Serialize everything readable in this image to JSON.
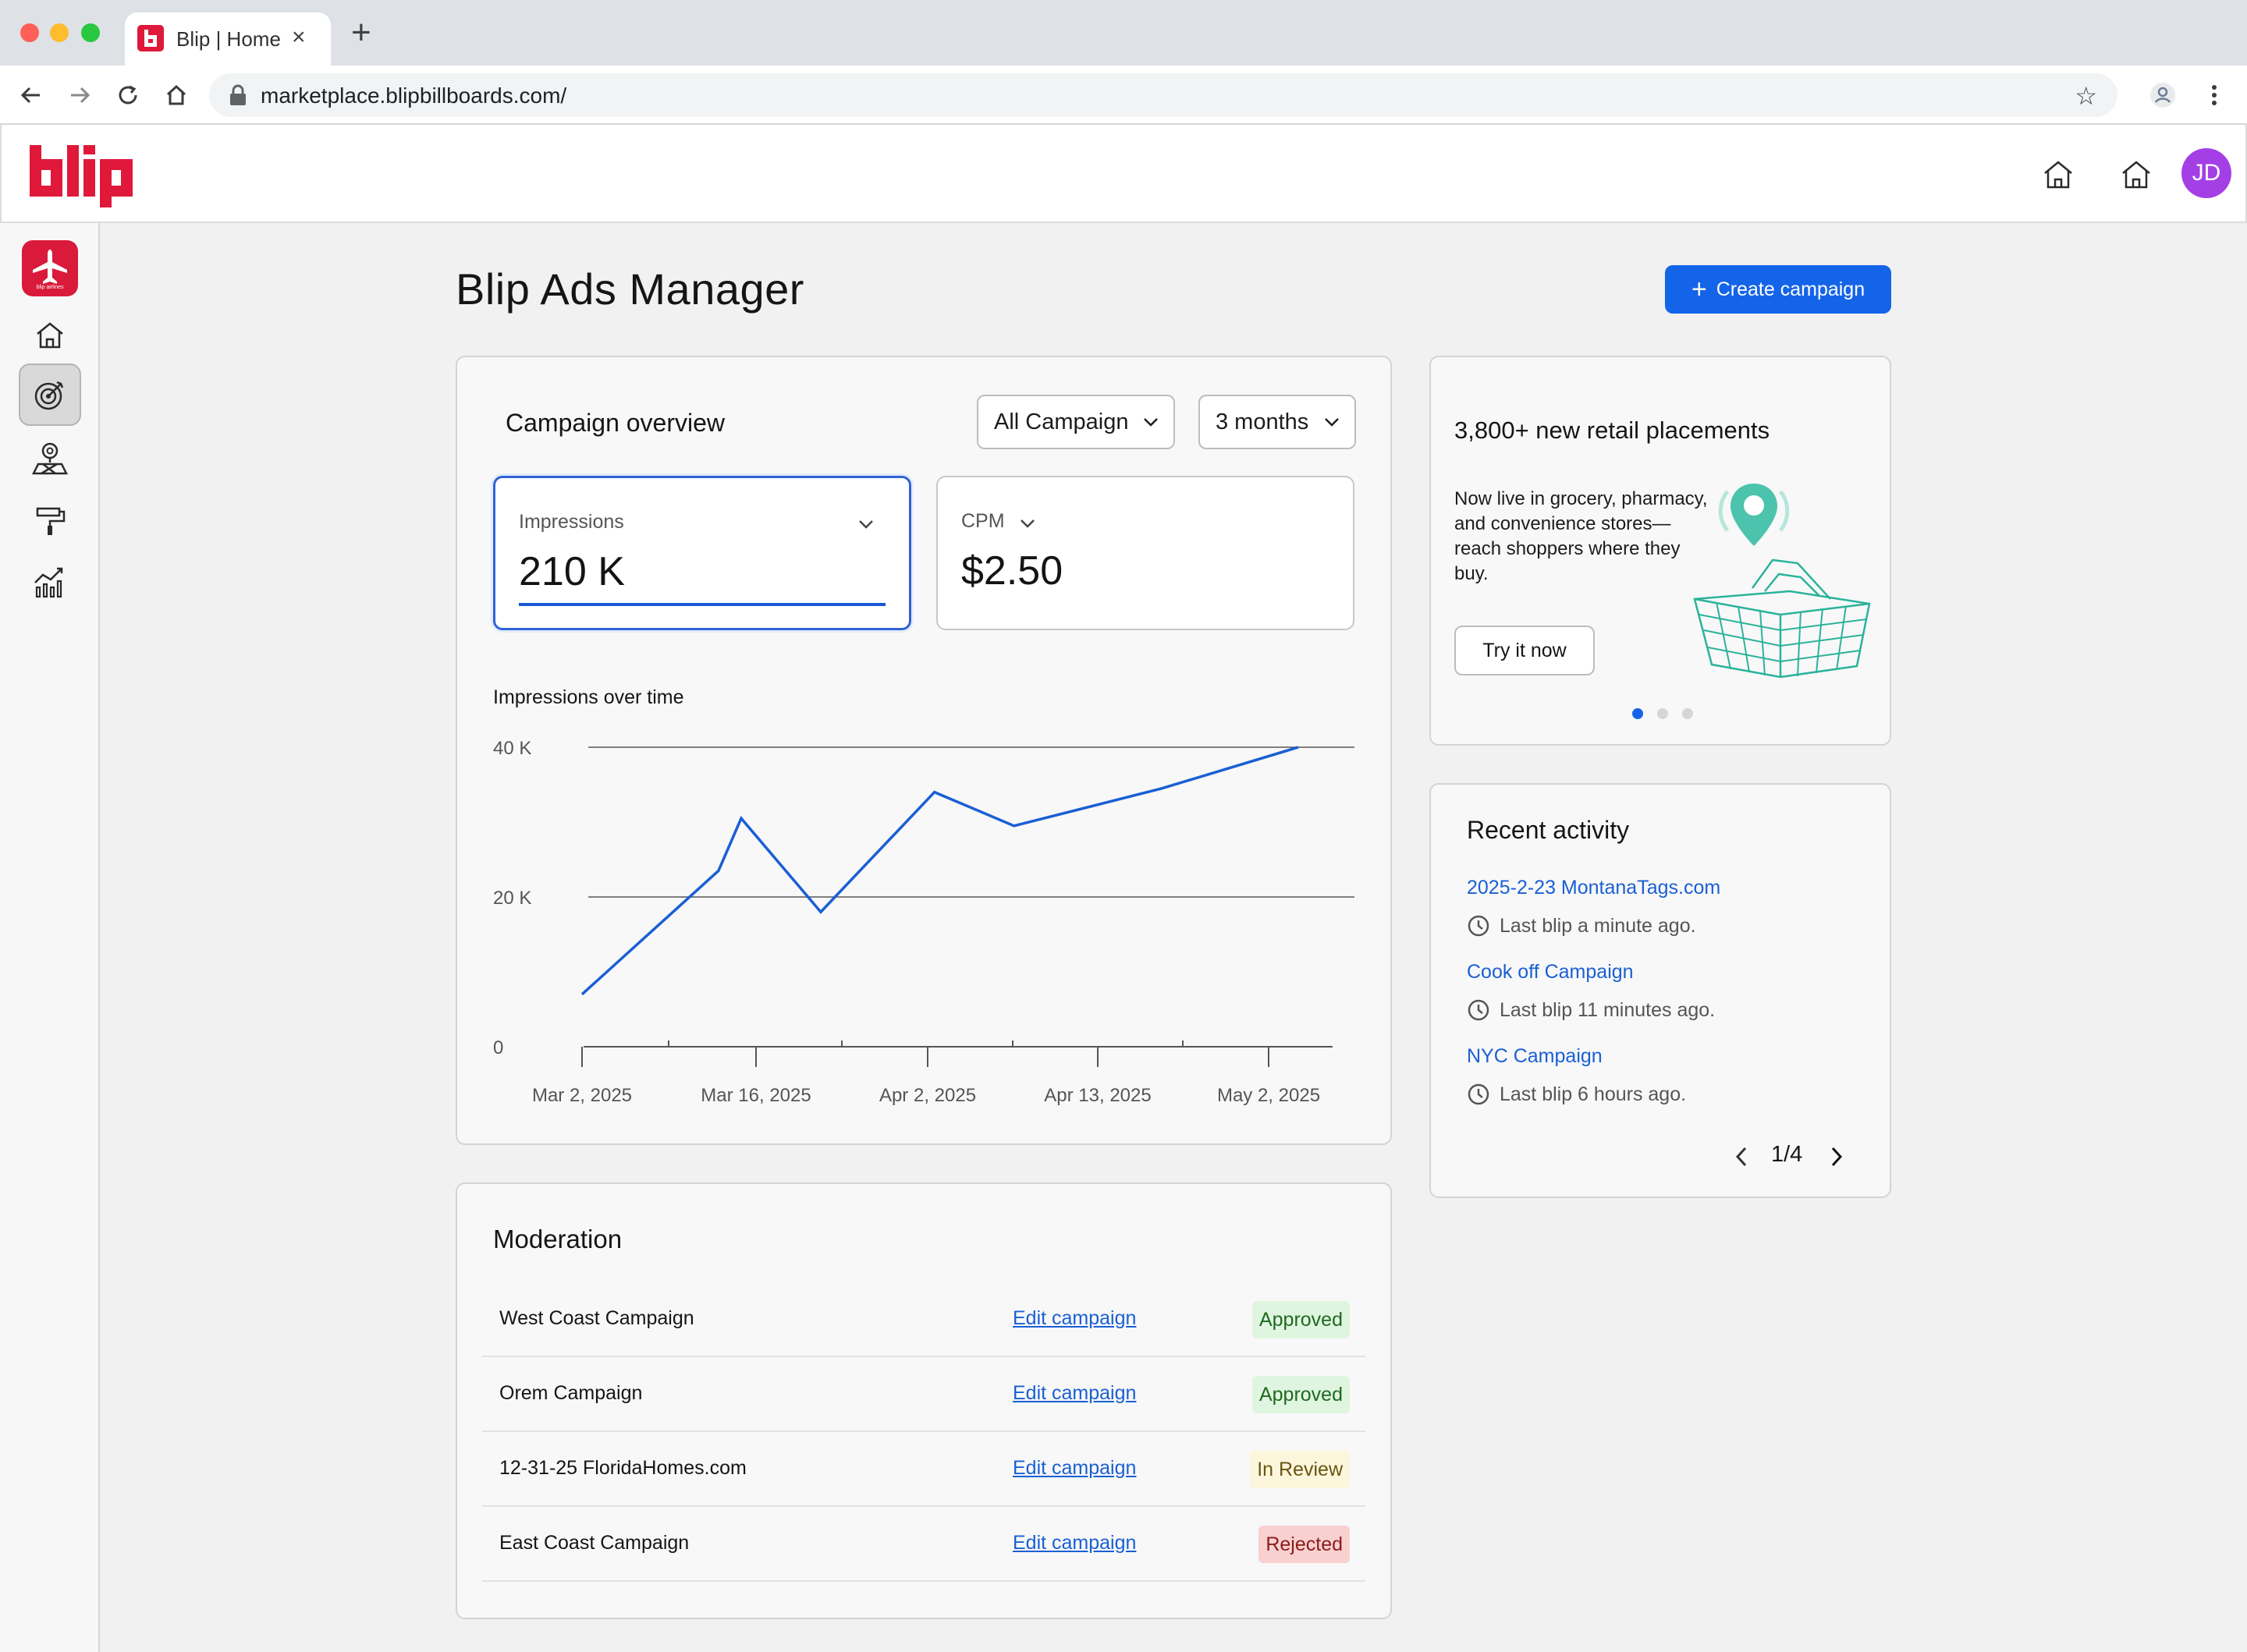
{
  "browser": {
    "tab_title": "Blip | Home",
    "url": "marketplace.blipbillboards.com/"
  },
  "header": {
    "logo_text": "blip",
    "avatar_initials": "JD"
  },
  "sidebar": {
    "brand_caption": "blip airlines",
    "items": [
      {
        "icon": "home-icon"
      },
      {
        "icon": "target-icon",
        "active": true
      },
      {
        "icon": "map-pin-icon"
      },
      {
        "icon": "paint-roller-icon"
      },
      {
        "icon": "analytics-icon"
      }
    ]
  },
  "page": {
    "title": "Blip Ads Manager",
    "create_button": "Create campaign"
  },
  "overview": {
    "title": "Campaign overview",
    "campaign_filter": "All Campaign",
    "period_filter": "3 months",
    "metrics": [
      {
        "label": "Impressions",
        "value": "210 K",
        "selected": true
      },
      {
        "label": "CPM",
        "value": "$2.50",
        "selected": false
      }
    ],
    "chart_title": "Impressions over time"
  },
  "chart_data": {
    "type": "line",
    "title": "Impressions over time",
    "y_tick_labels": [
      "0",
      "20 K",
      "40 K"
    ],
    "x_tick_labels": [
      "Mar 2, 2025",
      "Mar 16, 2025",
      "Apr 2, 2025",
      "Apr 13, 2025",
      "May 2, 2025"
    ],
    "ylim": [
      0,
      40000
    ],
    "gridlines": true,
    "series": [
      {
        "color": "#1a5fd4",
        "points": [
          {
            "x": "2025-03-02",
            "y": 7000
          },
          {
            "x": "2025-03-14",
            "y": 23500
          },
          {
            "x": "2025-03-16",
            "y": 30500
          },
          {
            "x": "2025-03-23",
            "y": 18000
          },
          {
            "x": "2025-04-02",
            "y": 34000
          },
          {
            "x": "2025-04-09",
            "y": 29500
          },
          {
            "x": "2025-04-22",
            "y": 34500
          },
          {
            "x": "2025-05-04",
            "y": 40000
          }
        ]
      }
    ]
  },
  "moderation": {
    "title": "Moderation",
    "edit_label": "Edit campaign",
    "rows": [
      {
        "name": "West Coast Campaign",
        "status": "Approved"
      },
      {
        "name": "Orem Campaign",
        "status": "Approved"
      },
      {
        "name": "12-31-25 FloridaHomes.com",
        "status": "In Review"
      },
      {
        "name": "East Coast Campaign",
        "status": "Rejected"
      }
    ],
    "status_colors": {
      "Approved": {
        "bg": "#e0f5df",
        "fg": "#1e6a22"
      },
      "In Review": {
        "bg": "#fbf6dc",
        "fg": "#6a5510"
      },
      "Rejected": {
        "bg": "#f9d0d0",
        "fg": "#8a1c1c"
      }
    }
  },
  "promo": {
    "title": "3,800+ new retail placements",
    "text": "Now live in grocery, pharmacy, and convenience stores—reach shoppers where they buy.",
    "button": "Try it now",
    "active_slide": 1,
    "slide_count": 3
  },
  "activity": {
    "title": "Recent activity",
    "items": [
      {
        "name": "2025-2-23 MontanaTags.com",
        "meta": "Last blip a minute ago."
      },
      {
        "name": "Cook off Campaign",
        "meta": "Last blip 11 minutes ago."
      },
      {
        "name": "NYC Campaign",
        "meta": "Last blip 6 hours ago."
      }
    ],
    "pager": "1/4"
  },
  "colors": {
    "brand_red": "#e0183a",
    "primary_blue": "#1464ea",
    "avatar_purple": "#a43fe6",
    "illustration_teal": "#2bb39b"
  }
}
